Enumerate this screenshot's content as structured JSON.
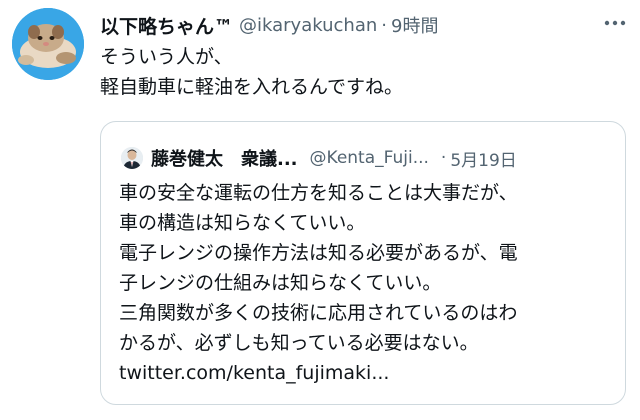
{
  "tweet": {
    "display_name": "以下略ちゃん™",
    "handle": "@ikaryakuchan",
    "separator": "·",
    "time": "9時間",
    "more_icon": "more-dots-icon",
    "text_lines": [
      "そういう人が、",
      "軽自動車に軽油を入れるんですね。"
    ]
  },
  "quote": {
    "display_name": "藤巻健太　衆議...",
    "handle": "@Kenta_Fuji...",
    "separator": "·",
    "time": "5月19日",
    "text_lines": [
      "車の安全な運転の仕方を知ることは大事だが、",
      "車の構造は知らなくていい。",
      "電子レンジの操作方法は知る必要があるが、電",
      "子レンジの仕組みは知らなくていい。",
      "三角関数が多くの技術に応用されているのはわ",
      "かるが、必ずしも知っている必要はない。",
      "twitter.com/kenta_fujimaki..."
    ]
  },
  "colors": {
    "text": "#0f1419",
    "secondary": "#536471",
    "border": "#cfd9de",
    "avatar_bg": "#2f9fe0"
  }
}
